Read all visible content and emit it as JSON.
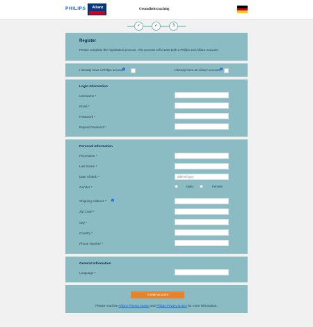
{
  "header": {
    "philips_logo": "PHILIPS",
    "allianz_logo": "Allianz",
    "allianz_sub": "",
    "program_title": "Gesundheitscoaching",
    "flag_colors": [
      "#000000",
      "#dd0000",
      "#ffce00"
    ]
  },
  "steps": [
    {
      "label": "✓"
    },
    {
      "label": "✓"
    },
    {
      "label": "3"
    }
  ],
  "register": {
    "title": "Register",
    "description": "Please complete the registration process. This process will create both a Philips and Allianz account."
  },
  "existing_accounts": {
    "philips_label": "I already have a Philips account",
    "allianz_label": "I already have an Allianz account"
  },
  "login": {
    "section_title": "Login Information",
    "fields": [
      {
        "label": "Username *",
        "value": ""
      },
      {
        "label": "Email *",
        "value": ""
      },
      {
        "label": "Password *",
        "value": ""
      },
      {
        "label": "Repeat Password *",
        "value": ""
      }
    ]
  },
  "personal": {
    "section_title": "Personal Information",
    "first_name": "First Name *",
    "last_name": "Last Name *",
    "dob_label": "Date of Birth *",
    "dob_placeholder": "dd/mm/yyyy",
    "gender_label": "Gender *",
    "gender_male": "Male",
    "gender_female": "Female",
    "shipping_address": "Shipping Address *",
    "zip_code": "Zip Code *",
    "city": "City *",
    "country": "Country *",
    "phone": "Phone Number *"
  },
  "general": {
    "section_title": "General Information",
    "language": "Language *"
  },
  "footer": {
    "create_button": "Create account",
    "privacy_prefix": "Please read the",
    "allianz_privacy": "Allianz Privacy Notice",
    "and": "and",
    "philips_privacy": "Philips Privacy Notice",
    "privacy_suffix": "for more information."
  },
  "colors": {
    "card_background": "#8cbcc3",
    "page_background": "#f1f1f1",
    "button": "#e8822b",
    "link": "#0b5ed7"
  }
}
